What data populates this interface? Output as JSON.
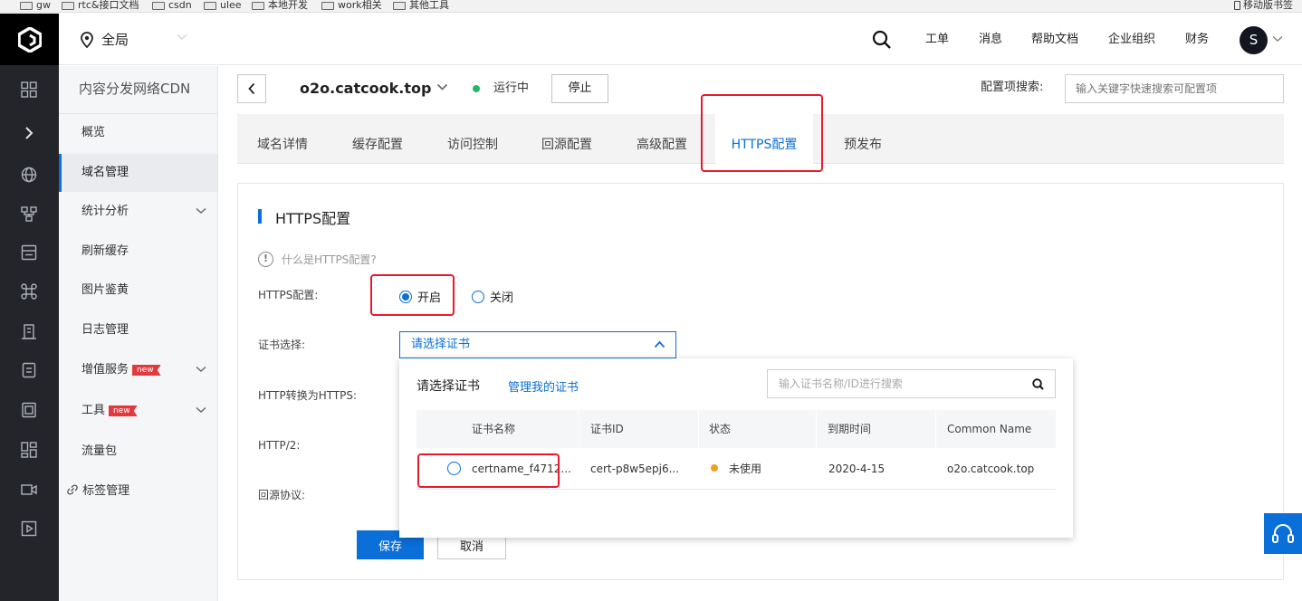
{
  "bookmarks": [
    {
      "label": "gw"
    },
    {
      "label": "rtc&接口文档"
    },
    {
      "label": "csdn"
    },
    {
      "label": "ulee"
    },
    {
      "label": "本地开发"
    },
    {
      "label": "work相关"
    },
    {
      "label": "其他工具"
    }
  ],
  "mobile_bookmarks": "移动版书签",
  "header": {
    "region": "全局",
    "nav": [
      "工单",
      "消息",
      "帮助文档",
      "企业组织",
      "财务"
    ],
    "avatar_letter": "S"
  },
  "sidebar": {
    "title": "内容分发网络CDN",
    "items": [
      {
        "label": "概览"
      },
      {
        "label": "域名管理"
      },
      {
        "label": "统计分析"
      },
      {
        "label": "刷新缓存"
      },
      {
        "label": "图片鉴黄"
      },
      {
        "label": "日志管理"
      },
      {
        "label": "增值服务",
        "badge": "new"
      },
      {
        "label": "工具",
        "badge": "new"
      },
      {
        "label": "流量包"
      },
      {
        "label": "标签管理"
      }
    ]
  },
  "page": {
    "domain": "o2o.catcook.top",
    "status": "运行中",
    "status_color": "#29b765",
    "stop_label": "停止",
    "cfg_search_label": "配置项搜索:",
    "cfg_search_placeholder": "输入关键字快速搜索可配置项"
  },
  "tabs": [
    {
      "label": "域名详情"
    },
    {
      "label": "缓存配置"
    },
    {
      "label": "访问控制"
    },
    {
      "label": "回源配置"
    },
    {
      "label": "高级配置"
    },
    {
      "label": "HTTPS配置"
    },
    {
      "label": "预发布"
    }
  ],
  "section": {
    "title": "HTTPS配置",
    "help_text": "什么是HTTPS配置?",
    "https_label": "HTTPS配置:",
    "radio_on": "开启",
    "radio_off": "关闭",
    "cert_label": "证书选择:",
    "cert_placeholder": "请选择证书",
    "http_to_https_label": "HTTP转换为HTTPS:",
    "http2_label": "HTTP/2:",
    "origin_protocol_label": "回源协议:",
    "save_label": "保存",
    "cancel_label": "取消"
  },
  "dropdown": {
    "title": "请选择证书",
    "manage_link": "管理我的证书",
    "search_placeholder": "输入证书名称/ID进行搜索",
    "columns": [
      "证书名称",
      "证书ID",
      "状态",
      "到期时间",
      "Common Name"
    ],
    "rows": [
      {
        "name": "certname_f4712...",
        "id": "cert-p8w5epj6...",
        "status": "未使用",
        "status_color": "#f0a020",
        "expire": "2020-4-15",
        "common_name": "o2o.catcook.top"
      }
    ]
  },
  "colors": {
    "accent": "#0a6fd8",
    "annotation": "#e8192c",
    "rail": "#23252b"
  }
}
